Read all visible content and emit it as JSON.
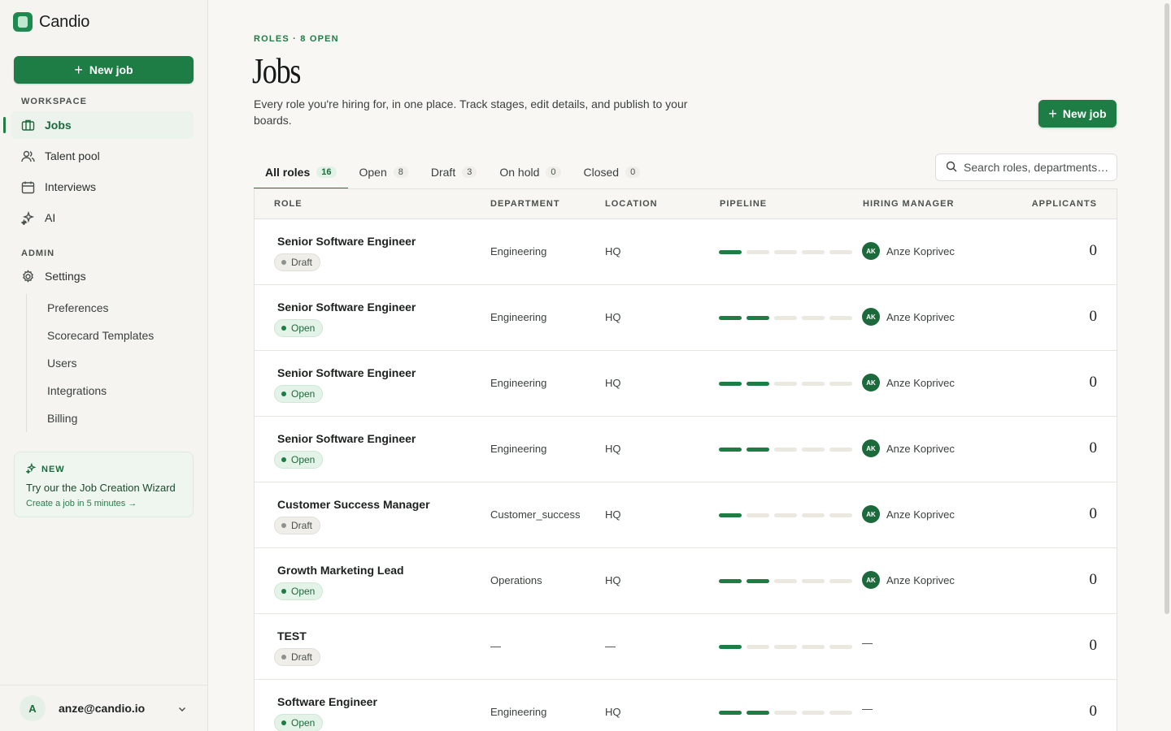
{
  "brand": {
    "name": "Candio"
  },
  "sidebar": {
    "new_job_label": "New job",
    "workspace_label": "WORKSPACE",
    "admin_label": "ADMIN",
    "items": [
      {
        "label": "Jobs",
        "icon": "briefcase-icon",
        "active": true
      },
      {
        "label": "Talent pool",
        "icon": "users-icon"
      },
      {
        "label": "Interviews",
        "icon": "calendar-icon"
      },
      {
        "label": "AI",
        "icon": "sparkles-icon"
      }
    ],
    "settings_label": "Settings",
    "settings_sub": [
      "Preferences",
      "Scorecard Templates",
      "Users",
      "Integrations",
      "Billing"
    ],
    "promo": {
      "tag": "NEW",
      "title": "Try our the Job Creation Wizard",
      "link": "Create a job in 5 minutes →"
    },
    "user": {
      "initial": "A",
      "email": "anze@candio.io"
    }
  },
  "header": {
    "eyebrow": "ROLES · 8 OPEN",
    "title": "Jobs",
    "description": "Every role you're hiring for, in one place. Track stages, edit details, and publish to your boards.",
    "new_job_label": "New job"
  },
  "tabs": [
    {
      "label": "All roles",
      "count": "16",
      "active": true
    },
    {
      "label": "Open",
      "count": "8"
    },
    {
      "label": "Draft",
      "count": "3"
    },
    {
      "label": "On hold",
      "count": "0"
    },
    {
      "label": "Closed",
      "count": "0"
    }
  ],
  "search": {
    "placeholder": "Search roles, departments…"
  },
  "table": {
    "columns": [
      "ROLE",
      "DEPARTMENT",
      "LOCATION",
      "PIPELINE",
      "HIRING MANAGER",
      "APPLICANTS"
    ],
    "rows": [
      {
        "role": "Senior Software Engineer",
        "status": "Draft",
        "department": "Engineering",
        "location": "HQ",
        "pipeline": 1,
        "manager": "Anze Koprivec",
        "manager_initials": "AK",
        "applicants": "0"
      },
      {
        "role": "Senior Software Engineer",
        "status": "Open",
        "department": "Engineering",
        "location": "HQ",
        "pipeline": 2,
        "manager": "Anze Koprivec",
        "manager_initials": "AK",
        "applicants": "0"
      },
      {
        "role": "Senior Software Engineer",
        "status": "Open",
        "department": "Engineering",
        "location": "HQ",
        "pipeline": 2,
        "manager": "Anze Koprivec",
        "manager_initials": "AK",
        "applicants": "0"
      },
      {
        "role": "Senior Software Engineer",
        "status": "Open",
        "department": "Engineering",
        "location": "HQ",
        "pipeline": 2,
        "manager": "Anze Koprivec",
        "manager_initials": "AK",
        "applicants": "0"
      },
      {
        "role": "Customer Success Manager",
        "status": "Draft",
        "department": "Customer_success",
        "location": "HQ",
        "pipeline": 1,
        "manager": "Anze Koprivec",
        "manager_initials": "AK",
        "applicants": "0"
      },
      {
        "role": "Growth Marketing Lead",
        "status": "Open",
        "department": "Operations",
        "location": "HQ",
        "pipeline": 2,
        "manager": "Anze Koprivec",
        "manager_initials": "AK",
        "applicants": "0"
      },
      {
        "role": "TEST",
        "status": "Draft",
        "department": "—",
        "location": "—",
        "pipeline": 1,
        "manager": "—",
        "manager_initials": "",
        "applicants": "0"
      },
      {
        "role": "Software Engineer",
        "status": "Open",
        "department": "Engineering",
        "location": "HQ",
        "pipeline": 2,
        "manager": "—",
        "manager_initials": "",
        "applicants": "0"
      }
    ]
  },
  "colors": {
    "accent": "#1e7d45",
    "accent_light": "#e4f3e7",
    "background": "#f8f7f4"
  }
}
